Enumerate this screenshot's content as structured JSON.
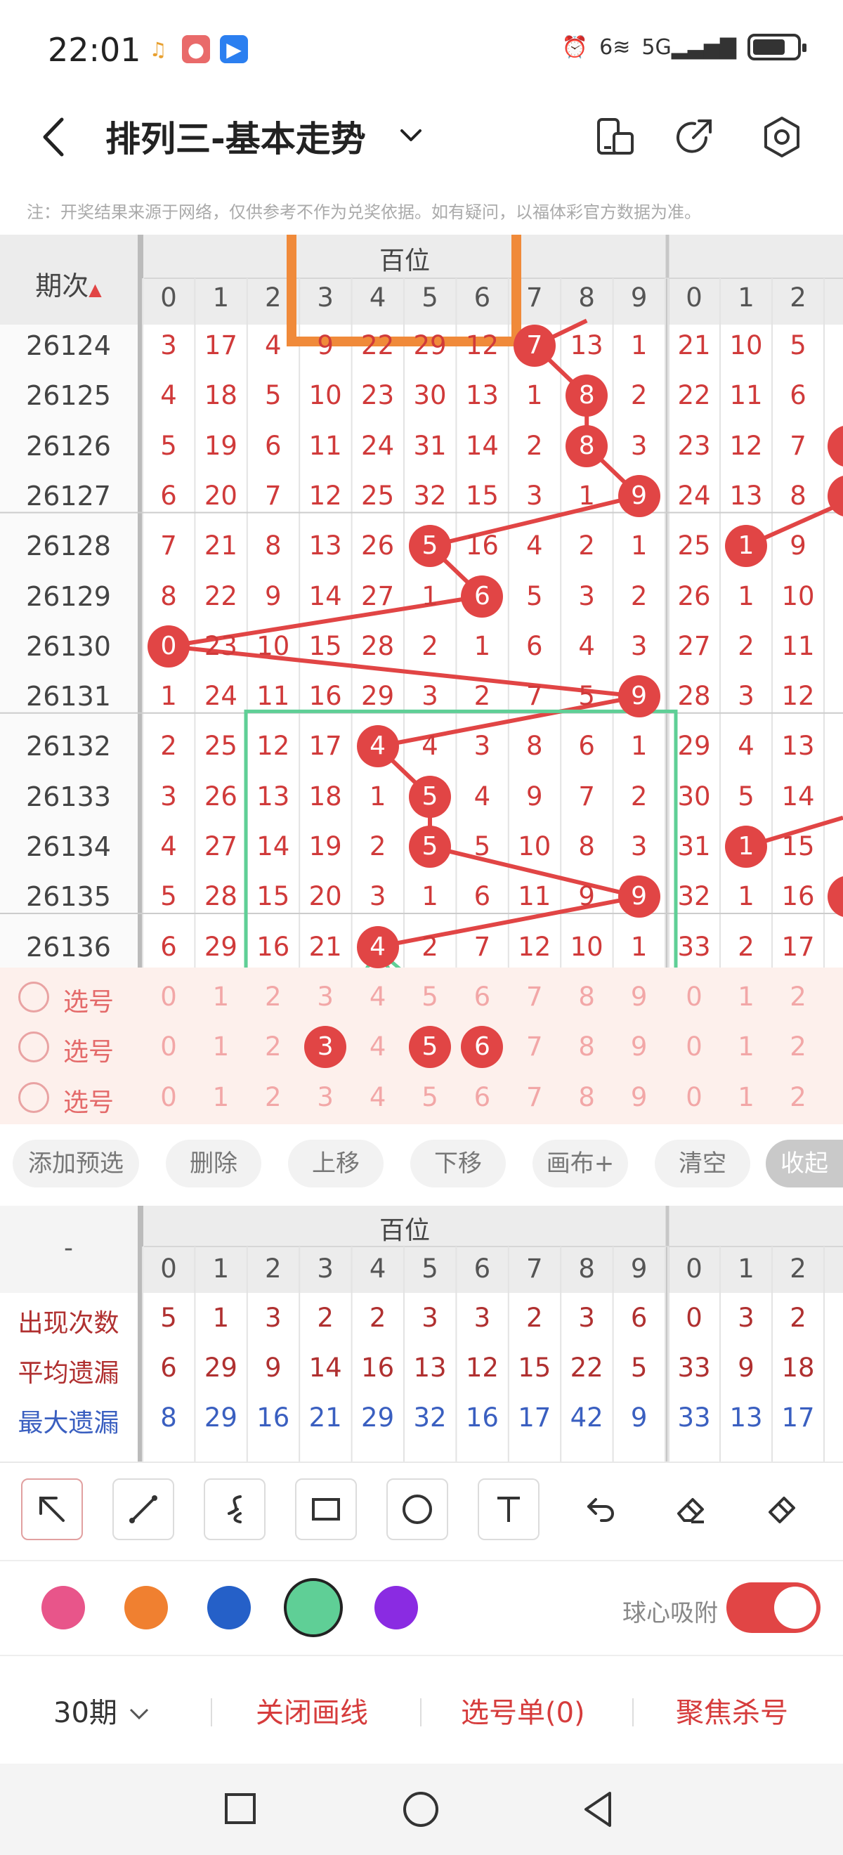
{
  "status": {
    "time": "22:01",
    "signal_text": "5G",
    "wifi_text": "6",
    "battery_level": 0.75
  },
  "header": {
    "title": "排列三-基本走势",
    "back_icon": "chevron-left-icon",
    "chevron_icon": "chevron-down-icon",
    "icons": [
      "phone-rotate-icon",
      "share-icon",
      "settings-icon"
    ]
  },
  "notice": "注：开奖结果来源于网络，仅供参考不作为兑奖依据。如有疑问，以福体彩官方数据为准。",
  "chart": {
    "period_header": "期次",
    "group_label": "百位",
    "digits": [
      "0",
      "1",
      "2",
      "3",
      "4",
      "5",
      "6",
      "7",
      "8",
      "9"
    ],
    "tens_digits": [
      "0",
      "1",
      "2"
    ],
    "rows": [
      {
        "period": "26124",
        "cells": [
          "3",
          "17",
          "4",
          "9",
          "22",
          "29",
          "12",
          "7",
          "13",
          "1"
        ],
        "hit": 7,
        "extra": [
          "21",
          "10",
          "5"
        ]
      },
      {
        "period": "26125",
        "cells": [
          "4",
          "18",
          "5",
          "10",
          "23",
          "30",
          "13",
          "1",
          "8",
          "2"
        ],
        "hit": 8,
        "extra": [
          "22",
          "11",
          "6"
        ]
      },
      {
        "period": "26126",
        "cells": [
          "5",
          "19",
          "6",
          "11",
          "24",
          "31",
          "14",
          "2",
          "8",
          "3"
        ],
        "hit": 8,
        "extra": [
          "23",
          "12",
          "7"
        ]
      },
      {
        "period": "26127",
        "cells": [
          "6",
          "20",
          "7",
          "12",
          "25",
          "32",
          "15",
          "3",
          "1",
          "9"
        ],
        "hit": 9,
        "extra": [
          "24",
          "13",
          "8"
        ]
      },
      {
        "period": "26128",
        "cells": [
          "7",
          "21",
          "8",
          "13",
          "26",
          "5",
          "16",
          "4",
          "2",
          "1"
        ],
        "hit": 5,
        "extra": [
          "25",
          "1",
          "9"
        ],
        "extra_hit": 1
      },
      {
        "period": "26129",
        "cells": [
          "8",
          "22",
          "9",
          "14",
          "27",
          "1",
          "6",
          "5",
          "3",
          "2"
        ],
        "hit": 6,
        "extra": [
          "26",
          "1",
          "10"
        ]
      },
      {
        "period": "26130",
        "cells": [
          "0",
          "23",
          "10",
          "15",
          "28",
          "2",
          "1",
          "6",
          "4",
          "3"
        ],
        "hit": 0,
        "extra": [
          "27",
          "2",
          "11"
        ]
      },
      {
        "period": "26131",
        "cells": [
          "1",
          "24",
          "11",
          "16",
          "29",
          "3",
          "2",
          "7",
          "5",
          "9"
        ],
        "hit": 9,
        "extra": [
          "28",
          "3",
          "12"
        ]
      },
      {
        "period": "26132",
        "cells": [
          "2",
          "25",
          "12",
          "17",
          "4",
          "4",
          "3",
          "8",
          "6",
          "1"
        ],
        "hit": 4,
        "extra": [
          "29",
          "4",
          "13"
        ]
      },
      {
        "period": "26133",
        "cells": [
          "3",
          "26",
          "13",
          "18",
          "1",
          "5",
          "4",
          "9",
          "7",
          "2"
        ],
        "hit": 5,
        "extra": [
          "30",
          "5",
          "14"
        ]
      },
      {
        "period": "26134",
        "cells": [
          "4",
          "27",
          "14",
          "19",
          "2",
          "5",
          "5",
          "10",
          "8",
          "3"
        ],
        "hit": 5,
        "extra": [
          "31",
          "1",
          "15"
        ],
        "extra_hit": 1
      },
      {
        "period": "26135",
        "cells": [
          "5",
          "28",
          "15",
          "20",
          "3",
          "1",
          "6",
          "11",
          "9",
          "9"
        ],
        "hit": 9,
        "extra": [
          "32",
          "1",
          "16"
        ]
      },
      {
        "period": "26136",
        "cells": [
          "6",
          "29",
          "16",
          "21",
          "4",
          "2",
          "7",
          "12",
          "10",
          "1"
        ],
        "hit": 4,
        "extra": [
          "33",
          "2",
          "17"
        ]
      }
    ],
    "pick_label": "选号",
    "pick_rows": 3,
    "picked_second_row": [
      3,
      5,
      6
    ]
  },
  "actions": [
    "添加预选",
    "删除",
    "上移",
    "下移",
    "画布+",
    "清空",
    "收起"
  ],
  "stats": {
    "corner": "-",
    "group_label": "百位",
    "rows": [
      {
        "label": "出现次数",
        "color": "#b03030",
        "values": [
          "5",
          "1",
          "3",
          "2",
          "2",
          "3",
          "3",
          "2",
          "3",
          "6"
        ],
        "extra": [
          "0",
          "3",
          "2"
        ]
      },
      {
        "label": "平均遗漏",
        "color": "#b03030",
        "values": [
          "6",
          "29",
          "9",
          "14",
          "16",
          "13",
          "12",
          "15",
          "22",
          "5"
        ],
        "extra": [
          "33",
          "9",
          "18"
        ]
      },
      {
        "label": "最大遗漏",
        "color": "#3a5fc0",
        "values": [
          "8",
          "29",
          "16",
          "21",
          "29",
          "32",
          "16",
          "17",
          "42",
          "9"
        ],
        "extra": [
          "33",
          "13",
          "17"
        ]
      }
    ]
  },
  "toolbar": {
    "tools": [
      "arrow-tool-icon",
      "line-tool-icon",
      "curve-tool-icon",
      "rectangle-tool-icon",
      "circle-tool-icon",
      "text-tool-icon",
      "undo-icon",
      "eraser-icon",
      "brush-icon"
    ]
  },
  "colors": {
    "swatches": [
      "#e8558a",
      "#f08030",
      "#2560c8",
      "#5fcf96",
      "#8a2be2"
    ],
    "selected_index": 3,
    "snap_label": "球心吸附",
    "snap_on": true
  },
  "bottom_bar": {
    "periods": "30期",
    "close_draw": "关闭画线",
    "pick_list": "选号单(0)",
    "focus_kill": "聚焦杀号"
  },
  "annotations": {
    "orange": "#f08a3a",
    "green": "#5fcf96",
    "red": "#e14545"
  }
}
